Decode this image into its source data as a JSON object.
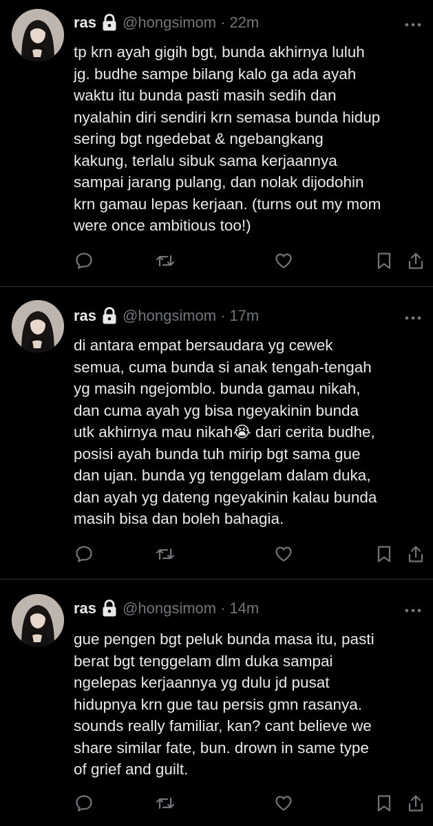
{
  "tweets": [
    {
      "name": "ras",
      "handle": "@hongsimom",
      "separator": "·",
      "time": "22m",
      "text": "tp krn ayah gigih bgt, bunda akhirnya luluh\njg. budhe sampe bilang kalo ga ada ayah\nwaktu itu bunda pasti masih sedih dan\nnyalahin diri sendiri krn semasa bunda hidup\nsering bgt ngedebat & ngebangkang\nkakung, terlalu sibuk sama kerjaannya\nsampai jarang pulang, dan nolak dijodohin\nkrn gamau lepas kerjaan. (turns out my mom\nwere once ambitious too!)"
    },
    {
      "name": "ras",
      "handle": "@hongsimom",
      "separator": "·",
      "time": "17m",
      "text": "di antara empat bersaudara yg cewek\nsemua, cuma bunda si anak tengah-tengah\nyg masih ngejomblo. bunda gamau nikah,\ndan cuma ayah yg bisa ngeyakinin bunda\nutk akhirnya mau nikah😭 dari cerita budhe,\nposisi ayah bunda tuh mirip bgt sama gue\ndan ujan. bunda yg tenggelam dalam duka,\ndan ayah yg dateng ngeyakinin kalau bunda\nmasih bisa dan boleh bahagia."
    },
    {
      "name": "ras",
      "handle": "@hongsimom",
      "separator": "·",
      "time": "14m",
      "text": "gue pengen bgt peluk bunda masa itu, pasti\nberat bgt tenggelam dlm duka sampai\nngelepas kerjaannya yg dulu jd pusat\nhidupnya krn gue tau persis gmn rasanya.\nsounds really familiar, kan? cant believe we\nshare similar fate, bun. drown in same type\nof grief and guilt."
    }
  ],
  "icons": {
    "lock": "lock-icon",
    "more": "more-icon",
    "reply": "reply-icon",
    "retweet": "retweet-icon",
    "like": "heart-icon",
    "bookmark": "bookmark-icon",
    "share": "share-icon"
  },
  "colors": {
    "background": "#000000",
    "text": "#e7e9ea",
    "secondary": "#71767b",
    "divider": "#2f3336"
  }
}
